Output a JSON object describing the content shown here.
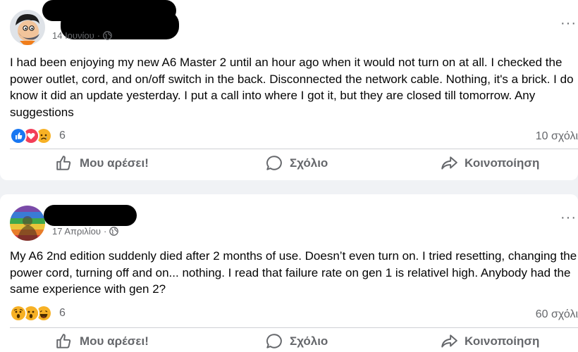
{
  "posts": [
    {
      "date": "14 Ιουνίου",
      "text": "I had been enjoying my new A6 Master 2 until an hour ago when it would not turn on at all. I checked the power outlet, cord, and on/off switch in the back. Disconnected the network cable. Nothing, it's a brick. I do know it did an update yesterday. I put a call into where I got it, but they are closed till tomorrow. Any suggestions",
      "reactions": [
        "like",
        "love",
        "sad"
      ],
      "reaction_count": "6",
      "comments_label": "10 σχόλι",
      "more": "···"
    },
    {
      "date": "17 Απριλίου",
      "text": "My A6 2nd edition suddenly died after 2 months of use. Doesn’t even turn on. I tried resetting, changing the power cord, turning off and on... nothing. I read that failure rate on gen 1 is relativel high. Anybody had the same experience with gen 2?",
      "reactions": [
        "wow",
        "wow",
        "haha"
      ],
      "reaction_count": "6",
      "comments_label": "60 σχόλι",
      "more": "···"
    }
  ],
  "actions": {
    "like": "Μου αρέσει!",
    "comment": "Σχόλιο",
    "share": "Κοινοποίηση"
  },
  "colors": {
    "like_blue": "#1877f2",
    "love_red": "#f33e58",
    "emoji_yellow": "#f7b125",
    "secondary_text": "#65676b"
  }
}
